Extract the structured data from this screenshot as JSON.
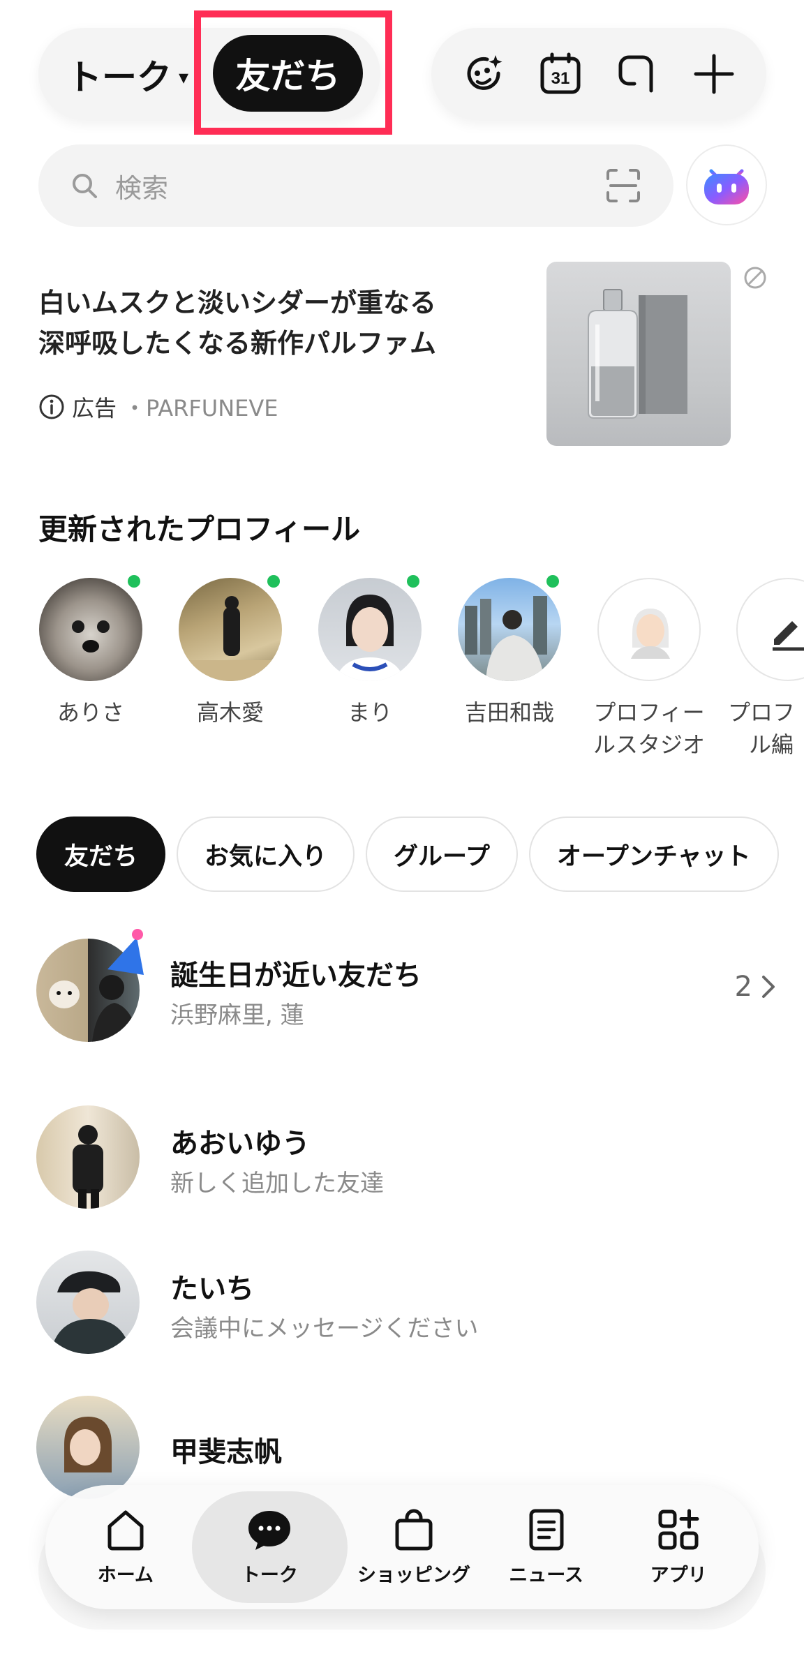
{
  "header": {
    "talk_label": "トーク",
    "friends_label": "友だち",
    "icons": [
      "sparkle-face-icon",
      "calendar-icon",
      "chat-square-icon",
      "plus-icon"
    ],
    "calendar_day": "31"
  },
  "search": {
    "placeholder": "検索"
  },
  "ad": {
    "title_line1": "白いムスクと淡いシダーが重なる",
    "title_line2": "深呼吸したくなる新作パルファム",
    "label": "広告",
    "sponsor": "・PARFUNEVE"
  },
  "profiles": {
    "title": "更新されたプロフィール",
    "items": [
      {
        "name": "ありさ",
        "online": true
      },
      {
        "name": "高木愛",
        "online": true
      },
      {
        "name": "まり",
        "online": true
      },
      {
        "name": "吉田和哉",
        "online": true
      },
      {
        "name_line1": "プロフィー",
        "name_line2": "ルスタジオ"
      },
      {
        "name_line1": "プロフ",
        "name_line2": "ル編"
      }
    ]
  },
  "tabs": [
    "友だち",
    "お気に入り",
    "グループ",
    "オープンチャット"
  ],
  "friends": [
    {
      "name": "誕生日が近い友だち",
      "sub": "浜野麻里, 蓮",
      "count": "2"
    },
    {
      "name": "あおいゆう",
      "sub": "新しく追加した友達"
    },
    {
      "name": "たいち",
      "sub": "会議中にメッセージください"
    },
    {
      "name": "甲斐志帆"
    }
  ],
  "nav": [
    "ホーム",
    "トーク",
    "ショッピング",
    "ニュース",
    "アプリ"
  ],
  "colors": {
    "highlight": "#ff2d55",
    "online": "#1fc05b",
    "dark": "#111111"
  }
}
